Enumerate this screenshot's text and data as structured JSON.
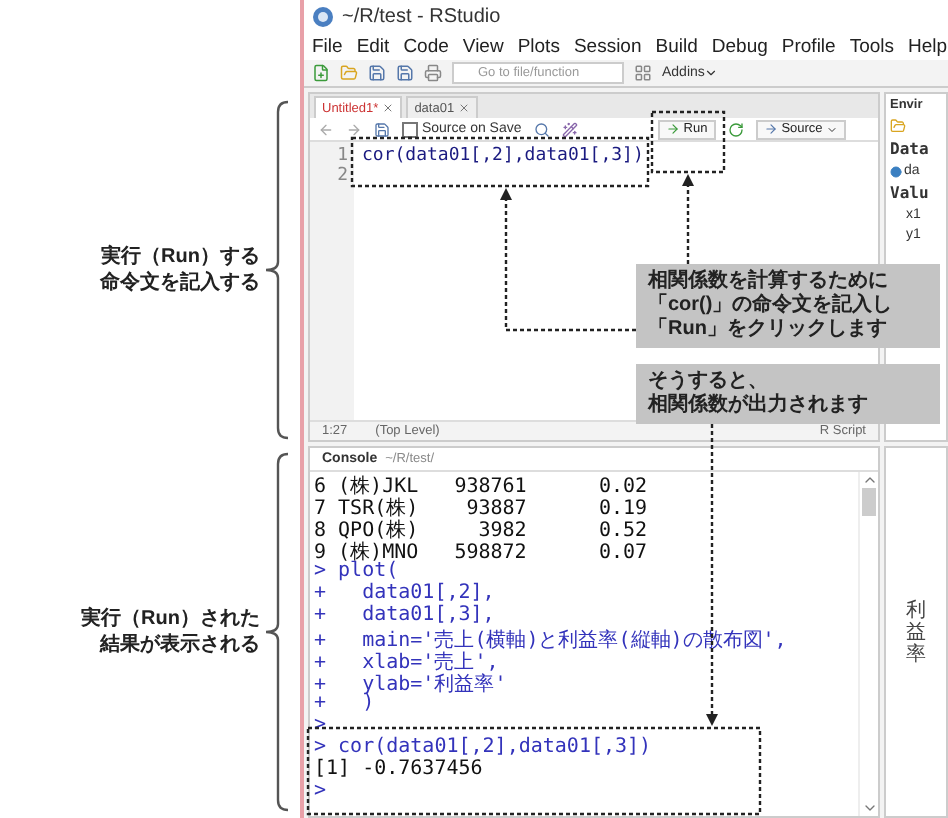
{
  "annotations": [
    {
      "lines": [
        "実行（Run）する",
        "命令文を記入する"
      ]
    },
    {
      "lines": [
        "実行（Run）された",
        "結果が表示される"
      ]
    }
  ],
  "window": {
    "title": "~/R/test - RStudio"
  },
  "menu": [
    "File",
    "Edit",
    "Code",
    "View",
    "Plots",
    "Session",
    "Build",
    "Debug",
    "Profile",
    "Tools",
    "Help"
  ],
  "toolbar": {
    "goto_placeholder": "Go to file/function",
    "addins": "Addins"
  },
  "source": {
    "tabs": [
      {
        "label": "Untitled1*",
        "selected": true
      },
      {
        "label": "data01",
        "selected": false
      }
    ],
    "source_on_save": {
      "label": "Source on Save",
      "checked": false
    },
    "run": "Run",
    "source_button": "Source",
    "lines": [
      {
        "number": "1",
        "code": "cor(data01[,2],data01[,3])"
      },
      {
        "number": "2"
      }
    ],
    "status": {
      "position": "1:27",
      "scope": "(Top Level)",
      "file_type": "R Script"
    }
  },
  "console": {
    "title": "Console",
    "path": "~/R/test/",
    "lines": [
      {
        "kind": "output",
        "text": "6 (株)JKL   938761      0.02"
      },
      {
        "kind": "output",
        "text": "7 TSR(株)    93887      0.19"
      },
      {
        "kind": "output",
        "text": "8 QPO(株)     3982      0.52"
      },
      {
        "kind": "output",
        "text": "9 (株)MNO   598872      0.07"
      },
      {
        "kind": "input",
        "text": "> plot("
      },
      {
        "kind": "input",
        "text": "+   data01[,2],"
      },
      {
        "kind": "input",
        "text": "+   data01[,3],"
      },
      {
        "kind": "input",
        "text": "+   main='売上(横軸)と利益率(縦軸)の散布図',"
      },
      {
        "kind": "input",
        "text": "+   xlab='売上',"
      },
      {
        "kind": "input",
        "text": "+   ylab='利益率'"
      },
      {
        "kind": "input",
        "text": "+   )"
      },
      {
        "kind": "input",
        "text": ">"
      },
      {
        "kind": "input",
        "text": "> cor(data01[,2],data01[,3])"
      },
      {
        "kind": "output",
        "text": "[1] -0.7637456"
      },
      {
        "kind": "input",
        "text": ">"
      }
    ]
  },
  "environment": {
    "tab": "Envir",
    "data_heading": "Data",
    "data_items": [
      "da"
    ],
    "values_heading": "Valu",
    "values": [
      "x1",
      "y1"
    ]
  },
  "plot": {
    "ylabel": "利益率"
  },
  "callouts": [
    {
      "lines": [
        "相関係数を計算するために",
        "「**cor()**」の命令文を記入し",
        "「**Run**」をクリックします"
      ]
    },
    {
      "lines": [
        "そうすると、",
        "相関係数が出力されます"
      ]
    }
  ]
}
